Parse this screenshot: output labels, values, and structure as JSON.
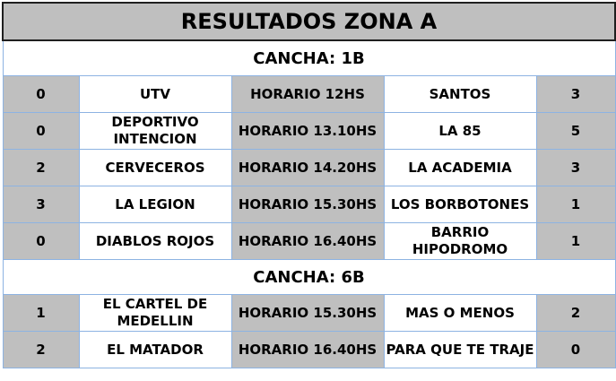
{
  "title": "RESULTADOS ZONA A",
  "sections": [
    {
      "cancha": "CANCHA: 1B",
      "matches": [
        {
          "home_score": "0",
          "home": "UTV",
          "time": "HORARIO 12HS",
          "away": "SANTOS",
          "away_score": "3"
        },
        {
          "home_score": "0",
          "home": "DEPORTIVO INTENCION",
          "time": "HORARIO 13.10HS",
          "away": "LA 85",
          "away_score": "5"
        },
        {
          "home_score": "2",
          "home": "CERVECEROS",
          "time": "HORARIO 14.20HS",
          "away": "LA ACADEMIA",
          "away_score": "3"
        },
        {
          "home_score": "3",
          "home": "LA LEGION",
          "time": "HORARIO 15.30HS",
          "away": "LOS BORBOTONES",
          "away_score": "1"
        },
        {
          "home_score": "0",
          "home": "DIABLOS ROJOS",
          "time": "HORARIO 16.40HS",
          "away": "BARRIO HIPODROMO",
          "away_score": "1"
        }
      ]
    },
    {
      "cancha": "CANCHA: 6B",
      "matches": [
        {
          "home_score": "1",
          "home": "EL CARTEL DE MEDELLIN",
          "time": "HORARIO 15.30HS",
          "away": "MAS O MENOS",
          "away_score": "2"
        },
        {
          "home_score": "2",
          "home": "EL MATADOR",
          "time": "HORARIO 16.40HS",
          "away": "PARA QUE TE TRAJE",
          "away_score": "0"
        }
      ]
    }
  ]
}
